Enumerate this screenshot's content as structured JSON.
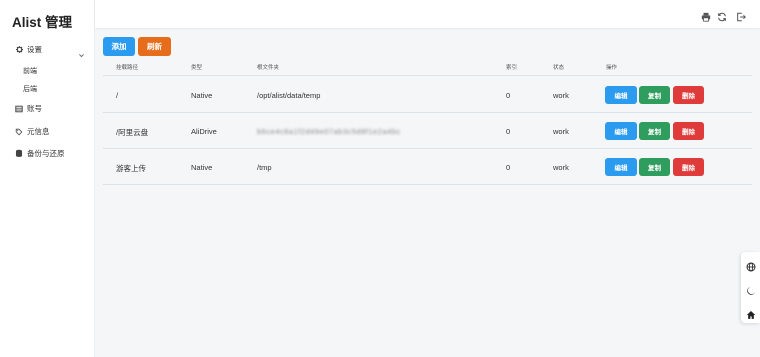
{
  "app": {
    "title": "Alist 管理"
  },
  "sidebar": {
    "settings": {
      "label": "设置",
      "children": [
        "前端",
        "后端"
      ]
    },
    "items": [
      {
        "label": "账号",
        "icon": "table-icon"
      },
      {
        "label": "元信息",
        "icon": "tag-icon"
      },
      {
        "label": "备份与还原",
        "icon": "database-icon"
      }
    ]
  },
  "toolbar": {
    "add_label": "添加",
    "refresh_label": "刷新"
  },
  "table": {
    "columns": [
      "挂载路径",
      "类型",
      "根文件夹",
      "索引",
      "状态",
      "操作"
    ],
    "rows": [
      {
        "path": "/",
        "type": "Native",
        "root": "/opt/alist/data/temp",
        "index": "0",
        "status": "work"
      },
      {
        "path": "/阿里云盘",
        "type": "AliDrive",
        "root": "b6ce4c8a1f2d49e07ab3c5d8f1e2a4bc",
        "index": "0",
        "status": "work"
      },
      {
        "path": "游客上传",
        "type": "Native",
        "root": "/tmp",
        "index": "0",
        "status": "work"
      }
    ],
    "actions": {
      "edit": "编辑",
      "copy": "复制",
      "delete": "删除"
    }
  },
  "colors": {
    "primary": "#2b9bf0",
    "warning": "#e66d1c",
    "success": "#2e9d5e",
    "danger": "#e03b3b"
  }
}
